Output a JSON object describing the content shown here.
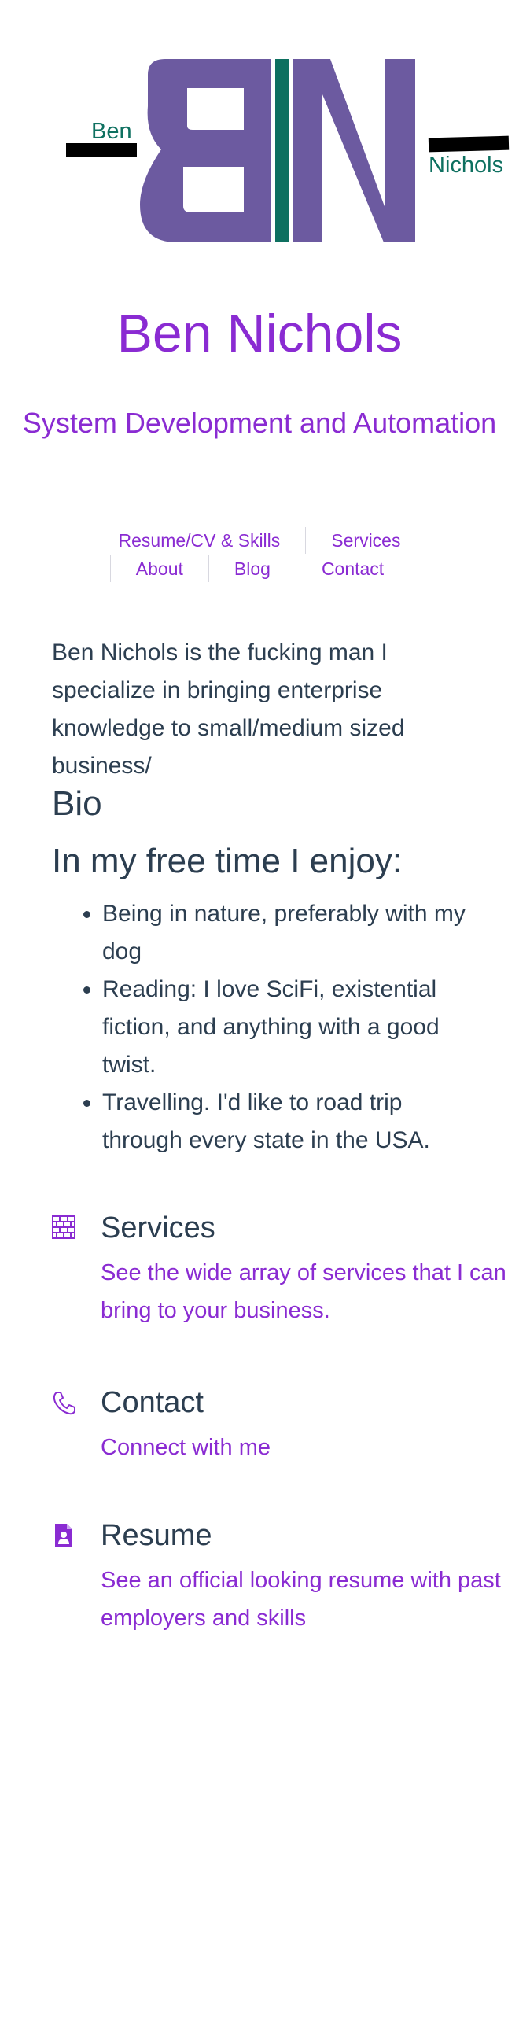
{
  "logo": {
    "left_word": "Ben",
    "right_word": "Nichols",
    "purple": "#6c5aa0",
    "green": "#0e7060",
    "black": "#000000"
  },
  "site": {
    "title": "Ben Nichols",
    "subtitle": "System Development and Automation"
  },
  "nav": [
    {
      "label": "Resume/CV & Skills"
    },
    {
      "label": "Services"
    },
    {
      "label": "About"
    },
    {
      "label": "Blog"
    },
    {
      "label": "Contact"
    }
  ],
  "about": {
    "intro": "Ben Nichols is the fucking man I specialize in bringing enterprise knowledge to small/medium sized business/",
    "bio_heading": "Bio",
    "free_time_heading": "In my free time I enjoy:",
    "hobbies": [
      "Being in nature, preferably with my dog",
      "Reading: I love SciFi, existential fiction, and anything with a good twist.",
      "Travelling. I'd like to road trip through every state in the USA."
    ]
  },
  "features": [
    {
      "icon": "brick-wall-icon",
      "title": "Services",
      "description": "See the wide array of services that I can bring to your business."
    },
    {
      "icon": "phone-icon",
      "title": "Contact",
      "description": "Connect with me"
    },
    {
      "icon": "resume-person-icon",
      "title": "Resume",
      "description": "See an official looking resume with past employers and skills"
    }
  ],
  "colors": {
    "accent": "#8a2bd2",
    "text": "#2c3e50",
    "divider": "#d8d8e0"
  }
}
